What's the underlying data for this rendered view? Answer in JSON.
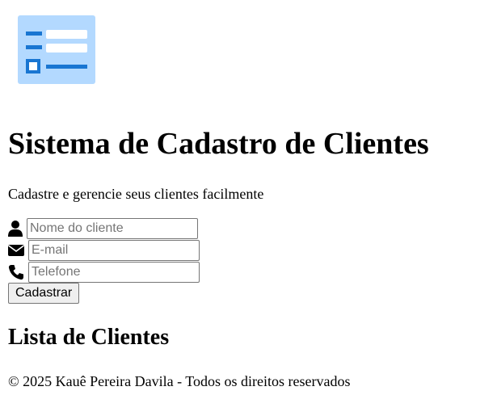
{
  "header": {
    "logo_icon": "client-list-icon",
    "title": "Sistema de Cadastro de Clientes",
    "subtitle": "Cadastre e gerencie seus clientes facilmente"
  },
  "form": {
    "name": {
      "icon": "user-icon",
      "placeholder": "Nome do cliente",
      "value": ""
    },
    "email": {
      "icon": "envelope-icon",
      "placeholder": "E-mail",
      "value": ""
    },
    "phone": {
      "icon": "phone-icon",
      "placeholder": "Telefone",
      "value": ""
    },
    "submit_label": "Cadastrar"
  },
  "client_list": {
    "title": "Lista de Clientes",
    "items": []
  },
  "footer": {
    "text": "© 2025 Kauê Pereira Davila - Todos os direitos reservados"
  },
  "colors": {
    "logo_background": "#b3d9ff",
    "logo_accent": "#1976d2",
    "logo_line": "#ffffff"
  }
}
